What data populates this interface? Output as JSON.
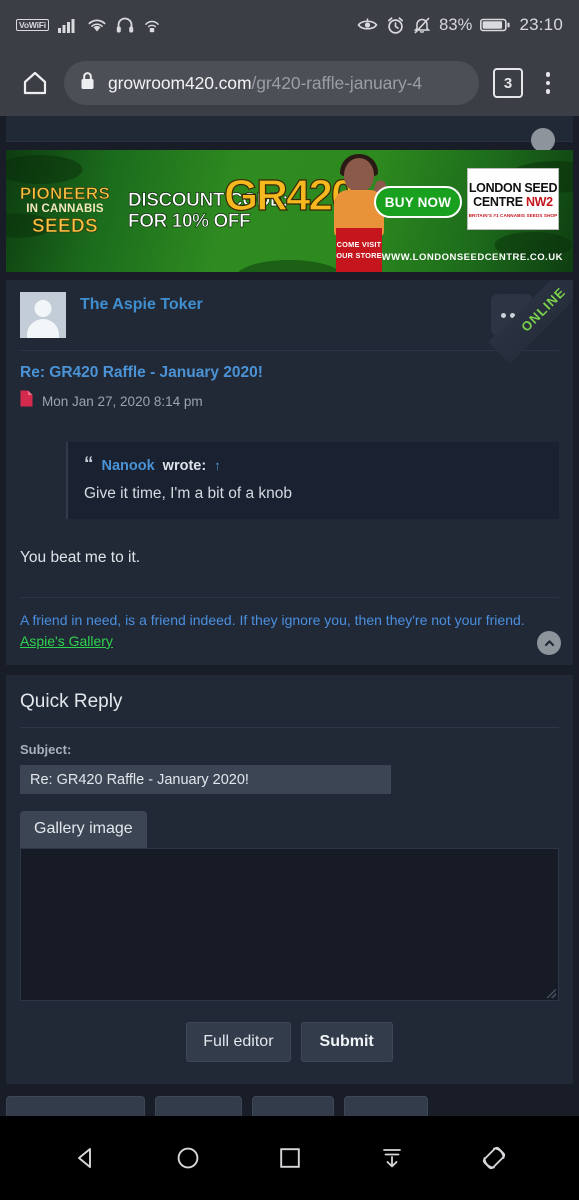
{
  "status_bar": {
    "vowifi_label": "VoWiFi",
    "icons_left": [
      "vowifi-icon",
      "signal-icon",
      "wifi-icon",
      "headphones-icon",
      "hotspot-icon"
    ],
    "icons_right": [
      "eye-icon",
      "alarm-icon",
      "mute-icon"
    ],
    "battery_percent": "83%",
    "clock": "23:10"
  },
  "browser": {
    "home_icon": "home-icon",
    "lock_icon": "lock-icon",
    "url_domain": "growroom420.com",
    "url_path": "/gr420-raffle-january-4",
    "tab_count": "3",
    "menu_icon": "kebab-menu-icon"
  },
  "ad": {
    "pioneers_line1": "PIONEERS",
    "pioneers_line2": "IN CANNABIS",
    "pioneers_line3": "SEEDS",
    "discount_line1": "DISCOUNT CODE:",
    "discount_line2": "FOR 10% OFF",
    "code": "GR420",
    "buy_now": "BUY NOW",
    "visit_line1": "COME VISIT",
    "visit_line2": "OUR STORE",
    "seed_centre_line1": "LONDON SEED",
    "seed_centre_line2": "CENTRE",
    "seed_centre_badge": "NW2",
    "seed_centre_tagline": "BRITAIN'S #1 CANNABIS SEEDS SHOP",
    "website": "WWW.LONDONSEEDCENTRE.CO.UK"
  },
  "post": {
    "online_badge": "ONLINE",
    "author": "The Aspie Toker",
    "avatar_icon": "default-avatar-icon",
    "menu_icon": "post-options-icon",
    "title": "Re: GR420 Raffle - January 2020!",
    "post_icon": "post-page-icon",
    "date": "Mon Jan 27, 2020 8:14 pm",
    "quote": {
      "mark": "“",
      "author": "Nanook",
      "wrote": "wrote:",
      "jump": "↑",
      "text": "Give it time, I'm a bit of a knob"
    },
    "body": "You beat me to it.",
    "signature_text": "A friend in need, is a friend indeed. If they ignore you, then they're not your friend.",
    "signature_link": "Aspie's Gallery",
    "scroll_top_icon": "scroll-to-top-icon"
  },
  "quick_reply": {
    "heading": "Quick Reply",
    "subject_label": "Subject:",
    "subject_value": "Re: GR420 Raffle - January 2020!",
    "gallery_tab": "Gallery image",
    "message_value": "",
    "full_editor_label": "Full editor",
    "submit_label": "Submit"
  },
  "bottom_partial_buttons": [
    "",
    "",
    "",
    ""
  ],
  "navbar": {
    "back_icon": "back-triangle-icon",
    "home_icon": "home-circle-icon",
    "recents_icon": "recents-square-icon",
    "scroll_down_icon": "scroll-down-icon",
    "rotate_icon": "rotate-screen-icon"
  },
  "colors": {
    "page_bg": "#181d27",
    "card_bg": "#222936",
    "link_blue": "#4a93d6",
    "sig_green": "#2fd24f",
    "online_green": "#7bd14b",
    "ad_green": "#2e8b20",
    "ad_gold": "#f5b91f",
    "status_bar_bg": "#3b3f45"
  }
}
